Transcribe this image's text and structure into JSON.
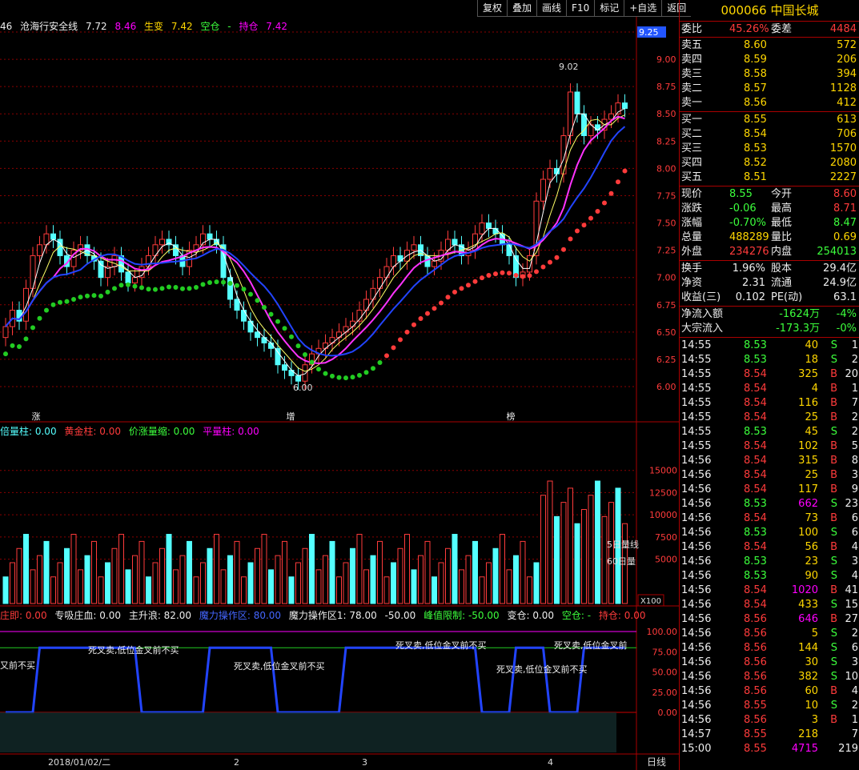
{
  "toolbar": [
    "复权",
    "叠加",
    "画线",
    "F10",
    "标记",
    "+自选",
    "返回"
  ],
  "stock": {
    "code": "000066",
    "name": "中国长城"
  },
  "main_header": {
    "prefix": "46",
    "title_label": "沧海行安全线",
    "title_val": "7.72",
    "v2": "8.46",
    "shengbian_label": "生变",
    "shengbian_val": "7.42",
    "kongcang_label": "空仓",
    "kongcang_val": "-",
    "chicang_label": "持仓",
    "chicang_val": "7.42"
  },
  "price_axis": [
    "9.25",
    "9.00",
    "8.75",
    "8.50",
    "8.25",
    "8.00",
    "7.75",
    "7.50",
    "7.25",
    "7.00",
    "6.75",
    "6.50",
    "6.25",
    "6.00"
  ],
  "price_marks": {
    "high": "9.02",
    "low": "6.00"
  },
  "main_tags": [
    "涨",
    "增",
    "榜"
  ],
  "vol_header": {
    "a": "倍量柱: 0.00",
    "b": "黄金柱: 0.00",
    "c": "价涨量缩: 0.00",
    "d": "平量柱: 0.00"
  },
  "vol_axis": [
    "15000",
    "12500",
    "10000",
    "7500",
    "5000"
  ],
  "vol_labels": {
    "ma5": "5日量线",
    "ma60": "60日量",
    "unit": "X100"
  },
  "ind_header": {
    "a": "庄即: 0.00",
    "b": "专吸庄血: 0.00",
    "c": "主升浪: 82.00",
    "d": "魔力操作区: 80.00",
    "e": "魔力操作区1: 78.00",
    "f": "-50.00",
    "g": "峰值限制: -50.00",
    "h": "变仓: 0.00",
    "i": "空仓: -",
    "j": "持仓: 0.00"
  },
  "ind_axis": [
    "100.00",
    "75.00",
    "50.00",
    "25.00",
    "0.00"
  ],
  "ind_texts": [
    "死叉卖,低位金叉前不买",
    "死叉卖,低位金叉前不买",
    "死叉卖,低位金叉前不买",
    "死叉卖,低位金叉前不买",
    "又前不买",
    "死叉卖,低位金叉前"
  ],
  "date_axis": {
    "d1": "2018/01/02/二",
    "d2": "2",
    "d3": "3",
    "d4": "4",
    "period": "日线"
  },
  "quote": {
    "weibi_label": "委比",
    "weibi": "45.26%",
    "weicha_label": "委差",
    "weicha": "4484",
    "sell": [
      {
        "l": "卖五",
        "p": "8.60",
        "v": "572"
      },
      {
        "l": "卖四",
        "p": "8.59",
        "v": "206"
      },
      {
        "l": "卖三",
        "p": "8.58",
        "v": "394"
      },
      {
        "l": "卖二",
        "p": "8.57",
        "v": "1128"
      },
      {
        "l": "卖一",
        "p": "8.56",
        "v": "412"
      }
    ],
    "buy": [
      {
        "l": "买一",
        "p": "8.55",
        "v": "613"
      },
      {
        "l": "买二",
        "p": "8.54",
        "v": "706"
      },
      {
        "l": "买三",
        "p": "8.53",
        "v": "1570"
      },
      {
        "l": "买四",
        "p": "8.52",
        "v": "2080"
      },
      {
        "l": "买五",
        "p": "8.51",
        "v": "2227"
      }
    ],
    "stats": [
      [
        "现价",
        "8.55",
        "今开",
        "8.60"
      ],
      [
        "涨跌",
        "-0.06",
        "最高",
        "8.71"
      ],
      [
        "涨幅",
        "-0.70%",
        "最低",
        "8.47"
      ],
      [
        "总量",
        "488289",
        "量比",
        "0.69"
      ],
      [
        "外盘",
        "234276",
        "内盘",
        "254013"
      ]
    ],
    "stats2": [
      [
        "换手",
        "1.96%",
        "股本",
        "29.4亿"
      ],
      [
        "净资",
        "2.31",
        "流通",
        "24.9亿"
      ],
      [
        "收益(三)",
        "0.102",
        "PE(动)",
        "63.1"
      ]
    ],
    "flow": [
      [
        "净流入额",
        "-1624万",
        "-4%"
      ],
      [
        "大宗流入",
        "-173.3万",
        "-0%"
      ]
    ],
    "ticks": [
      [
        "14:55",
        "8.53",
        "40",
        "S",
        "1"
      ],
      [
        "14:55",
        "8.53",
        "18",
        "S",
        "2"
      ],
      [
        "14:55",
        "8.54",
        "325",
        "B",
        "20"
      ],
      [
        "14:55",
        "8.54",
        "4",
        "B",
        "1"
      ],
      [
        "14:55",
        "8.54",
        "116",
        "B",
        "7"
      ],
      [
        "14:55",
        "8.54",
        "25",
        "B",
        "2"
      ],
      [
        "14:55",
        "8.53",
        "45",
        "S",
        "2"
      ],
      [
        "14:55",
        "8.54",
        "102",
        "B",
        "5"
      ],
      [
        "14:56",
        "8.54",
        "315",
        "B",
        "8"
      ],
      [
        "14:56",
        "8.54",
        "25",
        "B",
        "3"
      ],
      [
        "14:56",
        "8.54",
        "117",
        "B",
        "9"
      ],
      [
        "14:56",
        "8.53",
        "662",
        "S",
        "23"
      ],
      [
        "14:56",
        "8.54",
        "73",
        "B",
        "6"
      ],
      [
        "14:56",
        "8.53",
        "100",
        "S",
        "6"
      ],
      [
        "14:56",
        "8.54",
        "56",
        "B",
        "4"
      ],
      [
        "14:56",
        "8.53",
        "23",
        "S",
        "3"
      ],
      [
        "14:56",
        "8.53",
        "90",
        "S",
        "4"
      ],
      [
        "14:56",
        "8.54",
        "1020",
        "B",
        "41"
      ],
      [
        "14:56",
        "8.54",
        "433",
        "S",
        "15"
      ],
      [
        "14:56",
        "8.56",
        "646",
        "B",
        "27"
      ],
      [
        "14:56",
        "8.56",
        "5",
        "S",
        "2"
      ],
      [
        "14:56",
        "8.56",
        "144",
        "S",
        "6"
      ],
      [
        "14:56",
        "8.56",
        "30",
        "S",
        "3"
      ],
      [
        "14:56",
        "8.56",
        "382",
        "S",
        "10"
      ],
      [
        "14:56",
        "8.56",
        "60",
        "B",
        "4"
      ],
      [
        "14:56",
        "8.55",
        "10",
        "S",
        "2"
      ],
      [
        "14:56",
        "8.56",
        "3",
        "B",
        "1"
      ],
      [
        "14:57",
        "8.55",
        "218",
        "",
        "7"
      ],
      [
        "15:00",
        "8.55",
        "4715",
        "",
        "219"
      ]
    ]
  },
  "colors": {
    "up": "#ff3b3b",
    "down": "#54ffff",
    "grid": "#8b0000",
    "ma1": "#ffffff",
    "ma2": "#ffff66",
    "ma3": "#ff33ff",
    "ma4": "#2244ff"
  }
}
